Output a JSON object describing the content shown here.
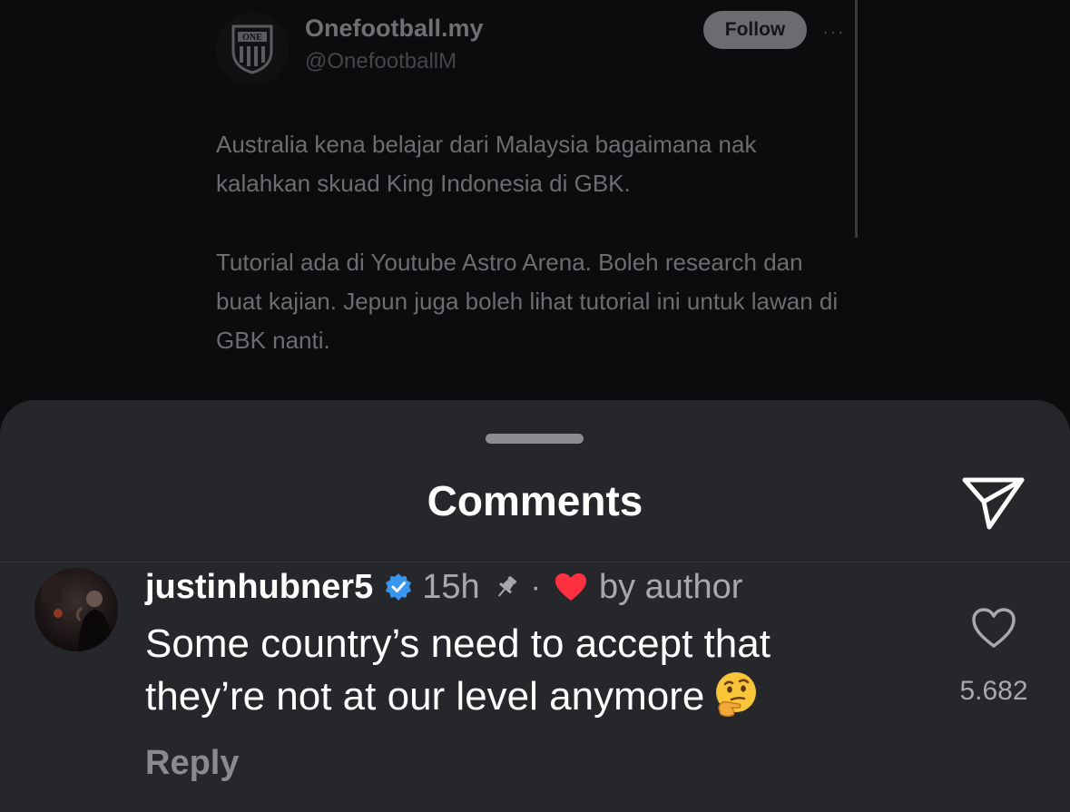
{
  "tweet": {
    "author_name": "Onefootball.my",
    "author_handle": "@OnefootballM",
    "follow_label": "Follow",
    "more_glyph": "···",
    "paragraph_1": "Australia kena belajar dari Malaysia bagaimana nak kalahkan skuad King Indonesia di GBK.",
    "paragraph_2": "Tutorial ada di Youtube Astro Arena. Boleh research dan buat kajian. Jepun juga boleh lihat tutorial ini untuk lawan di GBK nanti.",
    "logo_text": "ONE"
  },
  "sheet": {
    "title": "Comments"
  },
  "comment": {
    "username": "justinhubner5",
    "verified": true,
    "timestamp": "15h",
    "pinned": true,
    "separator": "·",
    "author_liked_label": "by author",
    "text": "Some country’s need to accept that they’re not at our level anymore",
    "emoji": "thinking-face",
    "reply_label": "Reply",
    "like_count": "5.682"
  },
  "colors": {
    "sheet_bg": "#25272b",
    "page_bg": "#0b0c0e",
    "verified_blue": "#3797f0",
    "heart_red": "#ff3040",
    "secondary_text": "#a8a9ad"
  },
  "icons": [
    "share-icon",
    "verified-icon",
    "pin-icon",
    "heart-icon",
    "like-outline-icon",
    "more-icon"
  ]
}
